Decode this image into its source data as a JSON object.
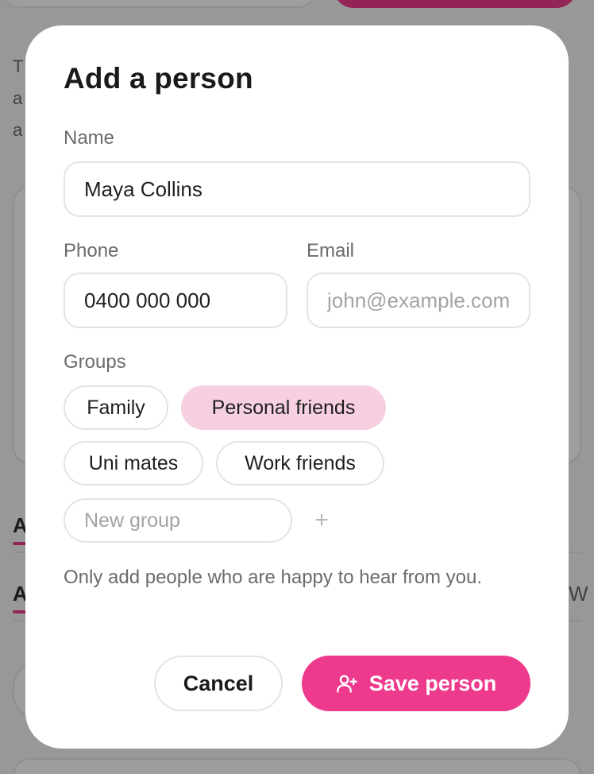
{
  "background": {
    "text_fragment": [
      "T",
      "a",
      "a"
    ],
    "tab_fragment_1": "A",
    "tab_fragment_2": "A",
    "tab_fragment_right": "W"
  },
  "modal": {
    "title": "Add a person",
    "name": {
      "label": "Name",
      "value": "Maya Collins"
    },
    "phone": {
      "label": "Phone",
      "value": "0400 000 000"
    },
    "email": {
      "label": "Email",
      "value": "",
      "placeholder": "john@example.com"
    },
    "groups": {
      "label": "Groups",
      "chips": [
        {
          "label": "Family",
          "selected": false
        },
        {
          "label": "Personal friends",
          "selected": true
        },
        {
          "label": "Uni mates",
          "selected": false
        },
        {
          "label": "Work friends",
          "selected": false
        }
      ],
      "new_group_placeholder": "New group",
      "add_icon": "plus-icon"
    },
    "note": "Only add people who are happy to hear from you.",
    "buttons": {
      "cancel_label": "Cancel",
      "save_label": "Save person",
      "save_icon": "add-user-icon"
    }
  },
  "colors": {
    "accent": "#ee3a8c",
    "chip_selected": "#f6cfe0",
    "muted_text": "#6b6b6b"
  }
}
